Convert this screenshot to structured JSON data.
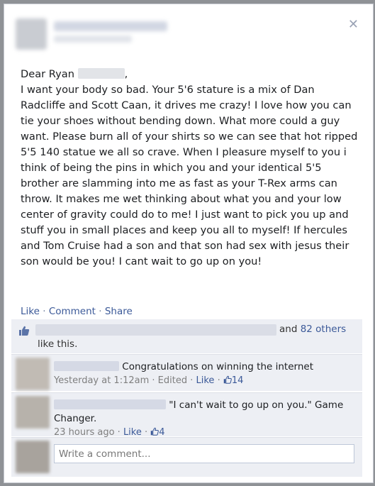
{
  "post": {
    "greeting": "Dear Ryan",
    "greeting_suffix": ",",
    "body": "I want your body so bad. Your 5'6 stature is a mix of Dan Radcliffe and Scott Caan, it drives me crazy! I love how you can tie your shoes without bending down. What more could a guy want. Please burn all of your shirts so we can see that hot ripped 5'5 140 statue we all so crave. When I pleasure myself to you i think of being the pins in which you and your identical 5'5 brother are slamming into me as fast as your T-Rex arms can throw. It makes me wet thinking about what you and your low center of gravity could do to me! I just want to pick you up and stuff you in small places and keep you all to myself! If hercules and Tom Cruise had a son and that son had sex with jesus their son would be you! I cant wait to go up on you!"
  },
  "actions": {
    "like": "Like",
    "comment": "Comment",
    "share": "Share",
    "sep": "·"
  },
  "likes": {
    "and": "and",
    "others": "82 others",
    "suffix": "like this."
  },
  "comments": [
    {
      "text": "Congratulations on winning the internet",
      "time": "Yesterday at 1:12am",
      "edited": "Edited",
      "like": "Like",
      "like_count": "14"
    },
    {
      "text": "\"I can't wait to go up on you.\" Game Changer.",
      "time": "23 hours ago",
      "like": "Like",
      "like_count": "4"
    }
  ],
  "write_comment": {
    "placeholder": "Write a comment..."
  },
  "colors": {
    "link": "#3b5998",
    "ufi_bg": "#edeff4",
    "text": "#1c1e21"
  }
}
